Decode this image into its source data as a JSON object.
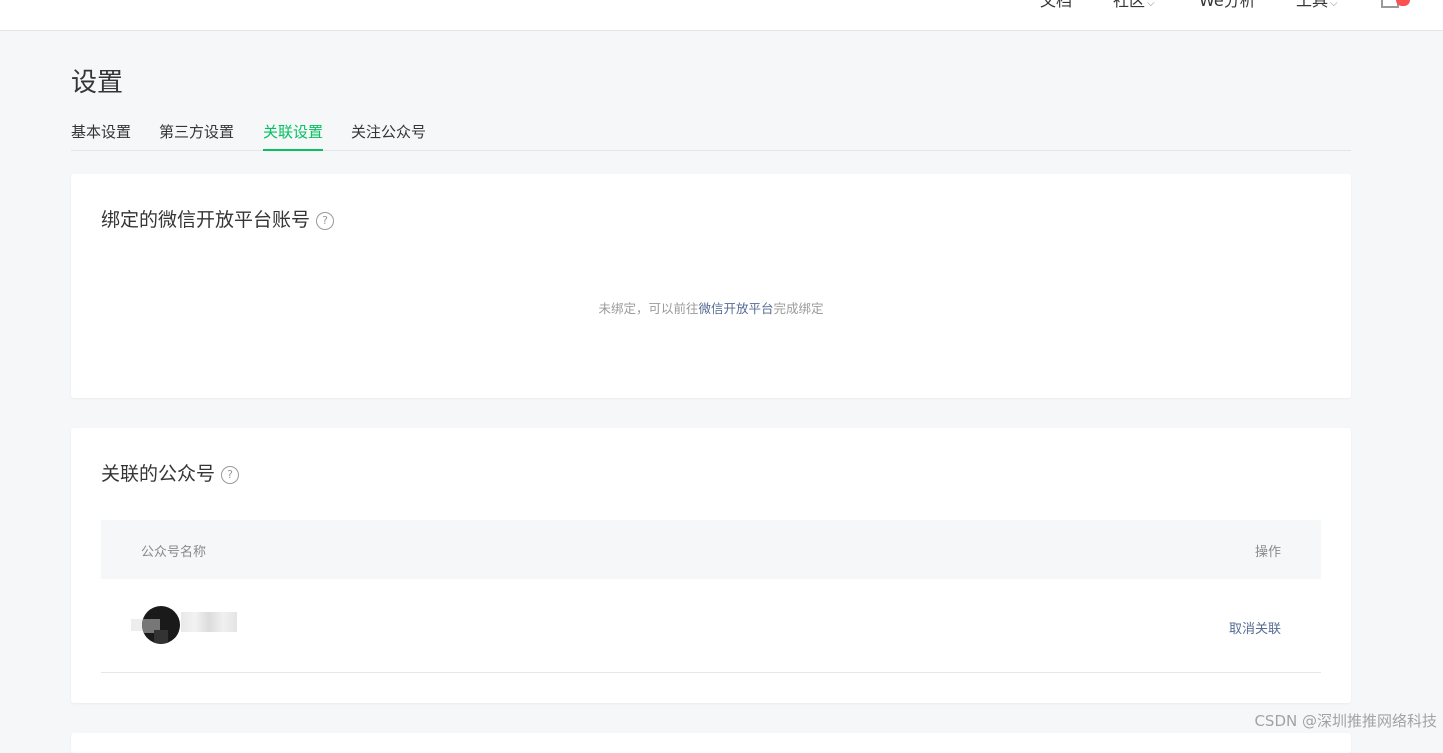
{
  "topbar": {
    "items": [
      {
        "label": "文档",
        "has_dropdown": false
      },
      {
        "label": "社区",
        "has_dropdown": true
      },
      {
        "label": "We分析",
        "has_dropdown": false
      },
      {
        "label": "工具",
        "has_dropdown": true
      }
    ],
    "notification_icon": "bell-icon",
    "accent_color": "#fa5151"
  },
  "page": {
    "title": "设置",
    "tabs": [
      {
        "label": "基本设置",
        "active": false
      },
      {
        "label": "第三方设置",
        "active": false
      },
      {
        "label": "关联设置",
        "active": true
      },
      {
        "label": "关注公众号",
        "active": false
      }
    ],
    "accent_color": "#07c160"
  },
  "open_platform": {
    "title": "绑定的微信开放平台账号",
    "help_icon": "question-circle-icon",
    "empty_prefix": "未绑定，可以前往",
    "empty_link": "微信开放平台",
    "empty_suffix": "完成绑定"
  },
  "linked_accounts": {
    "title": "关联的公众号",
    "help_icon": "question-circle-icon",
    "columns": [
      "公众号名称",
      "操作"
    ],
    "rows": [
      {
        "avatar": "avatar-icon",
        "action": "取消关联"
      }
    ]
  },
  "watermark": "CSDN @深圳推推网络科技"
}
